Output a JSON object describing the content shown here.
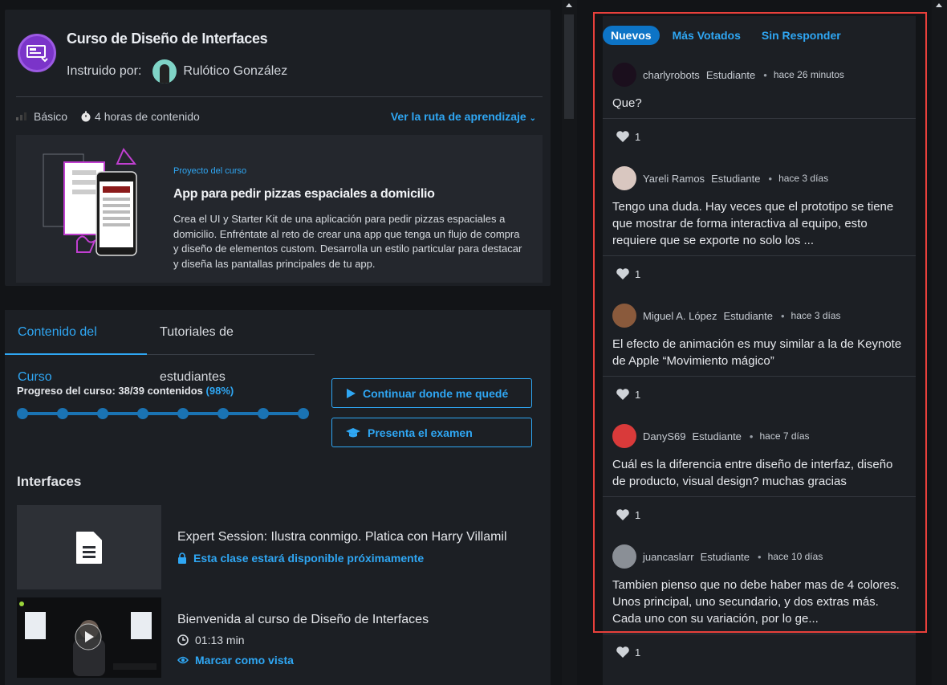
{
  "course": {
    "title": "Curso de Diseño de Interfaces",
    "instructor_label": "Instruido por:",
    "instructor_name": "Rulótico González",
    "level": "Básico",
    "hours": "4 horas de contenido",
    "route_link": "Ver la ruta de aprendizaje"
  },
  "project": {
    "tag": "Proyecto del curso",
    "title": "App para pedir pizzas espaciales a domicilio",
    "description": "Crea el UI y Starter Kit de una aplicación para pedir pizzas espaciales a domicilio. Enfréntate al reto de crear una app que tenga un flujo de compra y diseño de elementos custom. Desarrolla un estilo particular para destacar y diseña las pantallas principales de tu app."
  },
  "content_tabs": [
    "Contenido del Curso",
    "Tutoriales de estudiantes"
  ],
  "progress": {
    "label": "Progreso del curso: 38/39 contenidos",
    "percent_label": "(98%)",
    "value": 0.98
  },
  "buttons": {
    "continue": "Continuar donde me quedé",
    "exam": "Presenta el examen"
  },
  "section_title": "Interfaces",
  "lessons": [
    {
      "title": "Expert Session: Ilustra conmigo. Platica con Harry Villamil",
      "sub": "Esta clase estará disponible próximamente"
    },
    {
      "title": "Bienvenida al curso de Diseño de Interfaces",
      "duration": "01:13 min",
      "mark": "Marcar como vista"
    }
  ],
  "comment_tabs": [
    "Nuevos",
    "Más Votados",
    "Sin Responder"
  ],
  "comments": [
    {
      "user": "charlyrobots",
      "role": "Estudiante",
      "time": "hace 26 minutos",
      "text": "Que?",
      "likes": "1",
      "avatar_color": "#1b0f1d"
    },
    {
      "user": "Yareli Ramos",
      "role": "Estudiante",
      "time": "hace 3 días",
      "text": "Tengo una duda. Hay veces que el prototipo se tiene que mostrar de forma interactiva al equipo, esto requiere que se exporte no solo los ...",
      "likes": "1",
      "avatar_color": "#d9c7c0"
    },
    {
      "user": "Miguel A. López",
      "role": "Estudiante",
      "time": "hace 3 días",
      "text": "El efecto de animación es muy similar a la de Keynote de Apple “Movimiento mágico”",
      "likes": "1",
      "avatar_color": "#8a5a3c"
    },
    {
      "user": "DanyS69",
      "role": "Estudiante",
      "time": "hace 7 días",
      "text": "Cuál es la diferencia entre diseño de interfaz, diseño de producto, visual design? muchas gracias",
      "likes": "1",
      "avatar_color": "#d93a3a"
    },
    {
      "user": "juancaslarr",
      "role": "Estudiante",
      "time": "hace 10 días",
      "text": "Tambien pienso que no debe haber mas de 4 colores. Unos principal, uno secundario, y dos extras más. Cada uno con su variación, por lo ge...",
      "likes": "1",
      "avatar_color": "#8a8f96"
    }
  ],
  "colors": {
    "accent": "#2fa7f4",
    "highlight": "#e8403b",
    "tab_active": "#0d74c6"
  }
}
